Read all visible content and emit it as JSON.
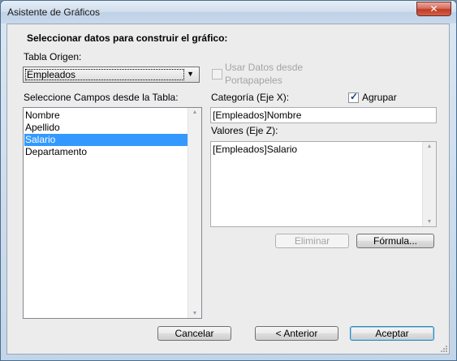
{
  "window": {
    "title": "Asistente de Gráficos"
  },
  "dialog": {
    "heading": "Seleccionar datos para construir el gráfico:",
    "source_table_label": "Tabla Origen:",
    "source_table_value": "Empleados",
    "use_clipboard_label_line1": "Usar Datos desde",
    "use_clipboard_label_line2": "Portapapeles",
    "use_clipboard_checked": false,
    "fields_label": "Seleccione Campos desde la Tabla:",
    "fields": [
      {
        "label": "Nombre",
        "selected": false
      },
      {
        "label": "Apellido",
        "selected": false
      },
      {
        "label": "Salario",
        "selected": true
      },
      {
        "label": "Departamento",
        "selected": false
      }
    ],
    "category_label": "Categoría (Eje X):",
    "group_label": "Agrupar",
    "group_checked": true,
    "category_value": "[Empleados]Nombre",
    "values_label": "Valores (Eje Z):",
    "values_value": "[Empleados]Salario",
    "remove_button": "Eliminar",
    "formula_button": "Fórmula...",
    "cancel_button": "Cancelar",
    "back_button": "< Anterior",
    "accept_button": "Aceptar"
  },
  "colors": {
    "selection": "#3399ff",
    "close_button": "#c13a22",
    "dialog_background": "#ececec"
  }
}
